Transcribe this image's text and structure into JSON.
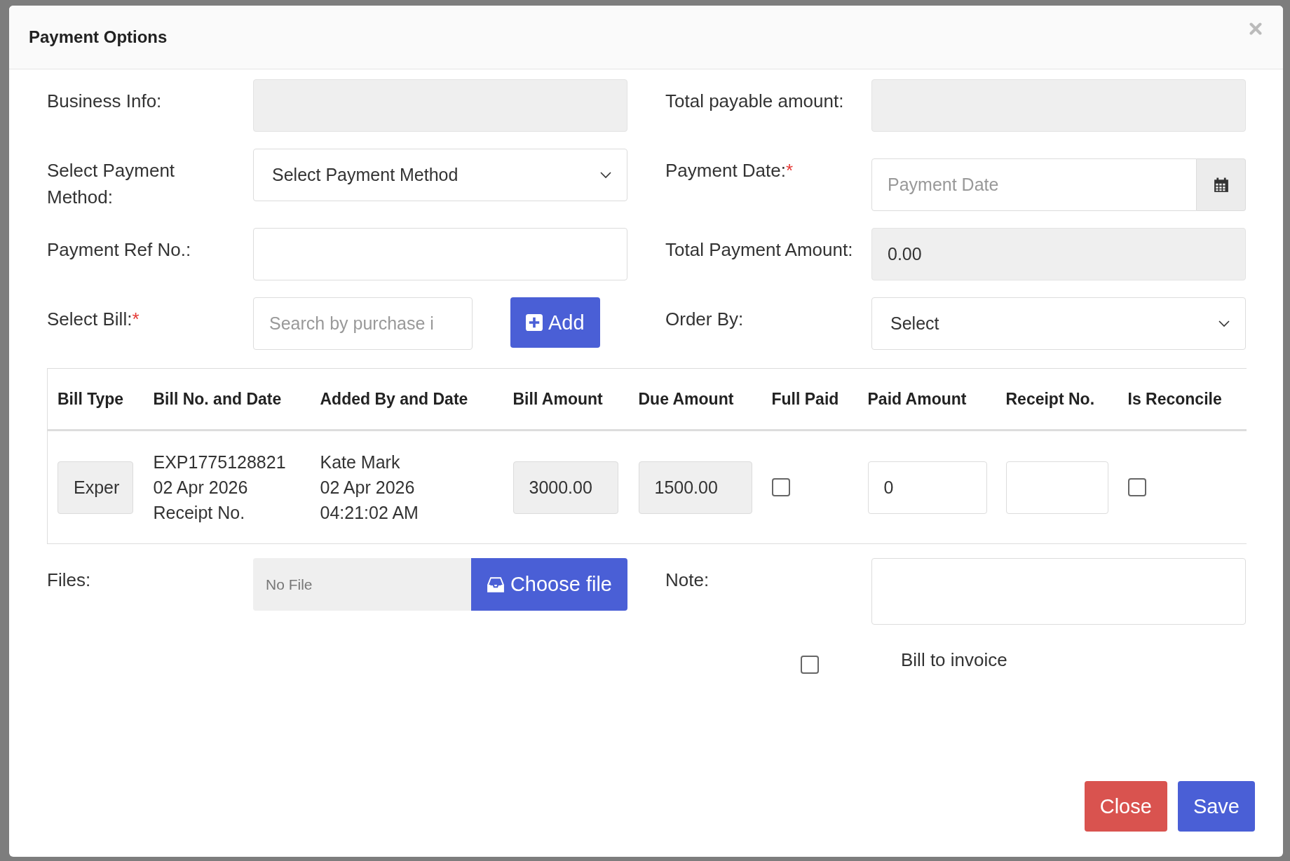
{
  "dialog": {
    "title": "Payment Options"
  },
  "form_rows": [
    {
      "left": {
        "label": "Business Info:",
        "kind": "readonly"
      },
      "right": {
        "label": "Total payable amount:",
        "kind": "readonly"
      }
    },
    {
      "left": {
        "label": "Select Payment Method:",
        "kind": "select",
        "value": "Select Payment Method"
      },
      "right": {
        "label": "Payment Date:",
        "required_mark": "*",
        "kind": "date",
        "placeholder": "Payment Date"
      }
    },
    {
      "left": {
        "label": "Payment Ref No.:",
        "kind": "text"
      },
      "right": {
        "label": "Total Payment Amount:",
        "kind": "readonly",
        "value": "0.00"
      }
    },
    {
      "left": {
        "label": "Select Bill:",
        "required_mark": "*",
        "kind": "search",
        "placeholder": "Search by purchase i",
        "button": "Add"
      },
      "right": {
        "label": "Order By:",
        "kind": "select",
        "value": "Select"
      }
    }
  ],
  "table": {
    "columns": [
      "Bill Type",
      "Bill No. and Date",
      "Added By and Date",
      "Bill Amount",
      "Due Amount",
      "Full Paid",
      "Paid Amount",
      "Receipt No.",
      "Is Reconcile"
    ],
    "rows": [
      {
        "bill_type": "Exper",
        "bill_no_and_date": [
          "EXP1775128821",
          "02 Apr 2026",
          "Receipt No."
        ],
        "added_by_and_date": [
          "Kate Mark",
          "02 Apr 2026",
          "04:21:02 AM"
        ],
        "bill_amount": "3000.00",
        "due_amount": "1500.00",
        "full_paid": false,
        "paid_amount": "0",
        "is_reconcile": false
      }
    ]
  },
  "files": {
    "label": "Files:",
    "value": "No File",
    "button": "Choose file"
  },
  "note": {
    "label": "Note:"
  },
  "bill_to_invoice": {
    "label": "Bill to invoice",
    "checked": false
  },
  "buttons": [
    {
      "label": "Close",
      "kind": "danger"
    },
    {
      "label": "Save",
      "kind": "primary"
    }
  ]
}
